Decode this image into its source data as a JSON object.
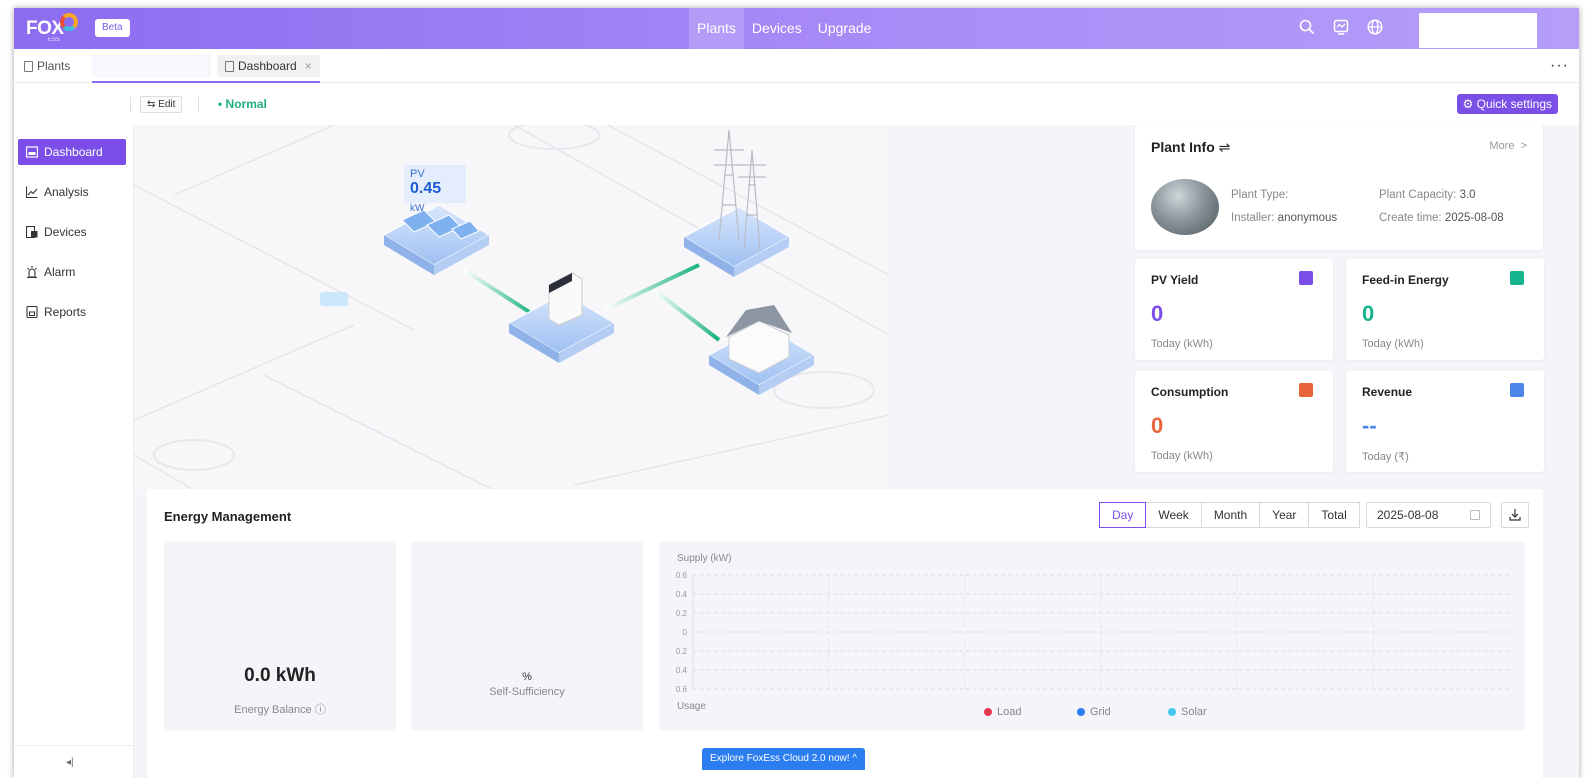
{
  "brand": {
    "logo": "FOX",
    "logo_sub": "ESS",
    "badge": "Beta"
  },
  "topnav": {
    "items": [
      "Plants",
      "Devices",
      "Upgrade"
    ],
    "active": "Plants"
  },
  "tabs": {
    "plants": "Plants",
    "dashboard": "Dashboard",
    "close": "×"
  },
  "toolbar": {
    "edit": "Edit",
    "status": "• Normal",
    "quick_settings": "Quick settings",
    "more": "···"
  },
  "sidebar": {
    "items": [
      {
        "label": "Dashboard",
        "icon": "dashboard-icon"
      },
      {
        "label": "Analysis",
        "icon": "analysis-icon"
      },
      {
        "label": "Devices",
        "icon": "devices-icon"
      },
      {
        "label": "Alarm",
        "icon": "alarm-icon"
      },
      {
        "label": "Reports",
        "icon": "reports-icon"
      }
    ],
    "collapse": "◂|"
  },
  "scene": {
    "pv_label": "PV",
    "pv_value": "0.45",
    "pv_unit": "kW"
  },
  "plant_info": {
    "title": "Plant Info",
    "more": "More",
    "plant_type_key": "Plant Type:",
    "plant_type_val": "",
    "installer_key": "Installer:",
    "installer_val": "anonymous",
    "capacity_key": "Plant Capacity:",
    "capacity_val": "3.0",
    "create_key": "Create time:",
    "create_val": "2025-08-08"
  },
  "stats": [
    {
      "label": "PV Yield",
      "value": "0",
      "unit": "Today (kWh)",
      "color": "#7b4ee9"
    },
    {
      "label": "Feed-in Energy",
      "value": "0",
      "unit": "Today (kWh)",
      "color": "#15b58d"
    },
    {
      "label": "Consumption",
      "value": "0",
      "unit": "Today (kWh)",
      "color": "#e8643a"
    },
    {
      "label": "Revenue",
      "value": "--",
      "unit": "Today (₹)",
      "color": "#4c86e8"
    }
  ],
  "energy": {
    "title": "Energy Management",
    "periods": [
      "Day",
      "Week",
      "Month",
      "Year",
      "Total"
    ],
    "active_period": "Day",
    "date": "2025-08-08",
    "balance_value": "0.0 kWh",
    "balance_label": "Energy Balance",
    "self_value": "%",
    "self_label": "Self-Sufficiency"
  },
  "chart_data": {
    "type": "line",
    "ylabel_top": "Supply (kW)",
    "ylabel_bottom": "Usage",
    "yticks": [
      "0.6",
      "0.4",
      "0.2",
      "0",
      "0.2",
      "0.4",
      "0.6"
    ],
    "ylim": [
      -0.6,
      0.6
    ],
    "grid": true,
    "legend_position": "bottom",
    "series": [
      {
        "name": "Load",
        "color": "#e8384f",
        "values": []
      },
      {
        "name": "Grid",
        "color": "#2f7cf0",
        "values": []
      },
      {
        "name": "Solar",
        "color": "#47c7ec",
        "values": []
      }
    ]
  },
  "explore": "Explore FoxEss Cloud 2.0 now!  ^"
}
